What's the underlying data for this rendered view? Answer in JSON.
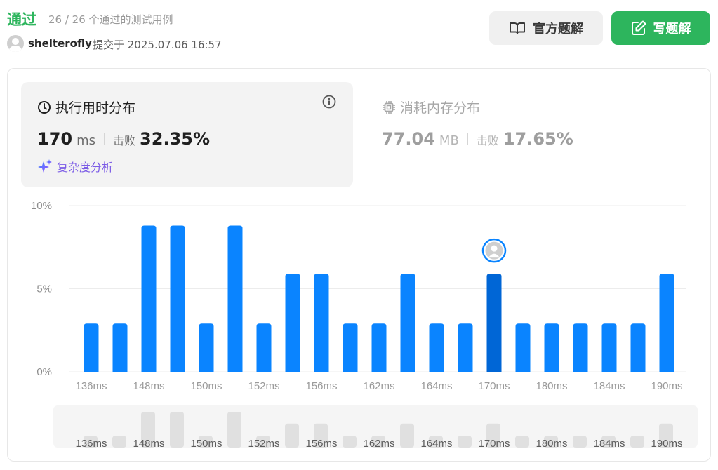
{
  "header": {
    "status": "通过",
    "count": "26 / 26 个通过的测试用例",
    "username": "shelterofly",
    "submitted": "提交于 2025.07.06 16:57",
    "official_solution": "官方题解",
    "write_solution": "写题解"
  },
  "runtime_card": {
    "title": "执行用时分布",
    "value": "170",
    "unit": "ms",
    "beat_label": "击败",
    "beat_value": "32.35%",
    "complexity_label": "复杂度分析",
    "icon": "clock-icon",
    "accent": "#7b5be6"
  },
  "memory_card": {
    "title": "消耗内存分布",
    "value": "77.04",
    "unit": "MB",
    "beat_label": "击败",
    "beat_value": "17.65%",
    "icon": "chip-icon"
  },
  "chart_data": {
    "type": "bar",
    "ylim": [
      0,
      10
    ],
    "y_ticks": [
      "10%",
      "5%",
      "0%"
    ],
    "x_tick_labels": [
      "136ms",
      "148ms",
      "150ms",
      "152ms",
      "156ms",
      "162ms",
      "164ms",
      "170ms",
      "180ms",
      "184ms",
      "190ms"
    ],
    "values": [
      2.9,
      2.9,
      8.8,
      8.8,
      2.9,
      8.8,
      2.9,
      5.9,
      5.9,
      2.9,
      2.9,
      5.9,
      2.9,
      2.9,
      5.9,
      2.9,
      2.9,
      2.9,
      2.9,
      2.9,
      5.9
    ],
    "highlight_index": 14,
    "bar_color": "#0a84ff",
    "highlight_color": "#0066d6",
    "brush_bar_color": "#e0e0e0",
    "grid": true
  }
}
